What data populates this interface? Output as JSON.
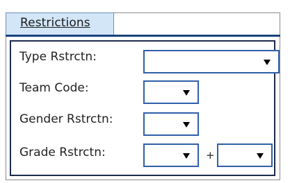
{
  "restrictions": {
    "tab_label": "Restrictions",
    "fields": {
      "type": {
        "label": "Type Rstrctn:",
        "value": ""
      },
      "team_code": {
        "label": "Team Code:",
        "value": ""
      },
      "gender": {
        "label": "Gender Rstrctn:",
        "value": ""
      },
      "grade": {
        "label": "Grade Rstrctn:",
        "from_value": "",
        "to_value": "",
        "separator": "+"
      }
    }
  },
  "icons": {
    "dropdown": "chevron-down-icon"
  }
}
